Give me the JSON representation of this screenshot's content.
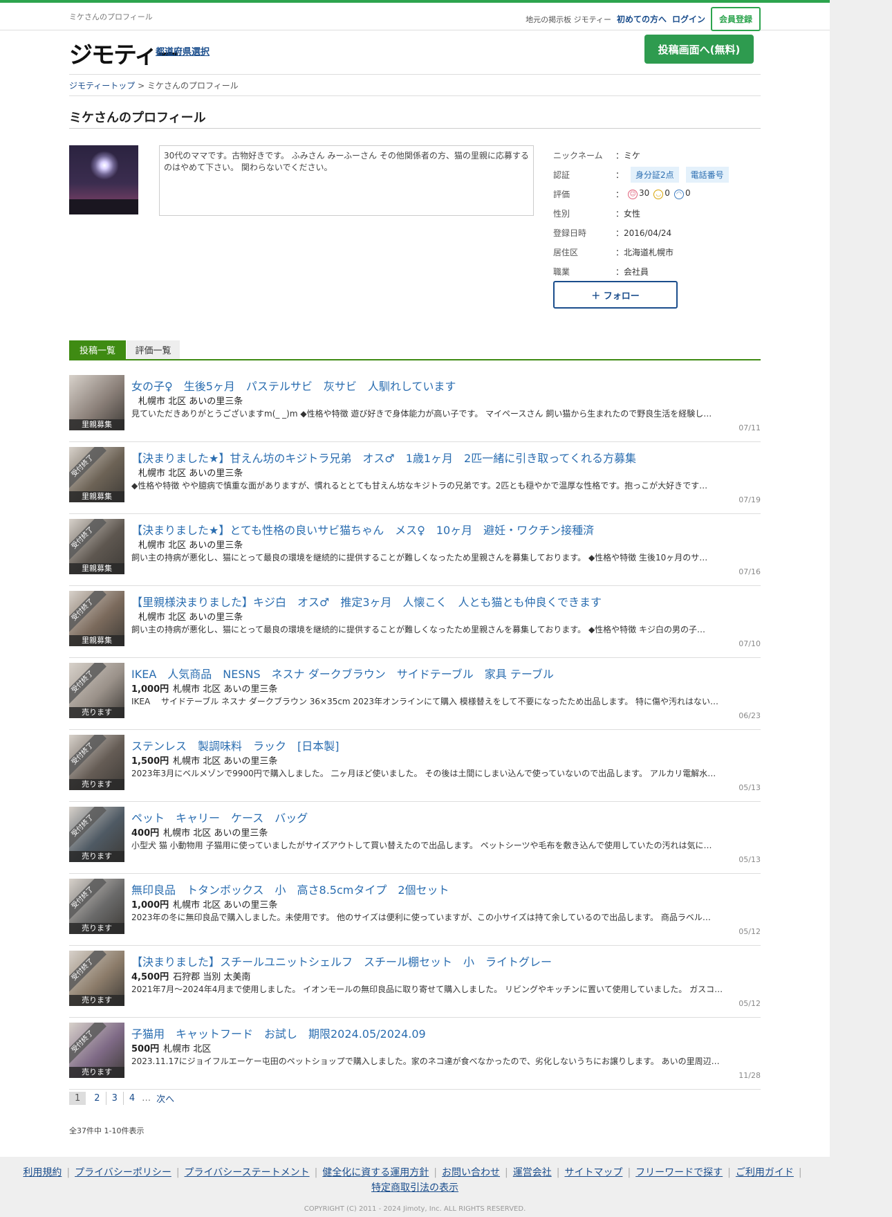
{
  "topbar": {
    "pagename": "ミケさんのプロフィール",
    "tagline": "地元の掲示板 ジモティー",
    "first_time": "初めての方へ",
    "login": "ログイン",
    "register": "会員登録"
  },
  "header": {
    "logo": "ジモティー",
    "pref": "都道府県選択",
    "post": "投稿画面へ(無料)"
  },
  "breadcrumb": {
    "home": "ジモティートップ",
    "sep": ">",
    "current": "ミケさんのプロフィール"
  },
  "profile": {
    "title": "ミケさんのプロフィール",
    "bio": "30代のママです。古物好きです。 ふみさん みーふーさん その他関係者の方、猫の里親に応募するのはやめて下さい。 関わらないでください。",
    "fields": {
      "nickname_k": "ニックネーム",
      "nickname_v": "：ミケ",
      "verify_k": "認証",
      "verify_sep": "：",
      "verify_id": "身分証2点",
      "verify_phone": "電話番号",
      "rating_k": "評価",
      "rating_sep": "：",
      "rating_good": "30",
      "rating_mid": "0",
      "rating_bad": "0",
      "gender_k": "性別",
      "gender_v": "：女性",
      "regdate_k": "登録日時",
      "regdate_v": "：2016/04/24",
      "area_k": "居住区",
      "area_v": "：北海道札幌市",
      "job_k": "職業",
      "job_v": "：会社員"
    },
    "follow": "＋ フォロー"
  },
  "tabs": {
    "posts": "投稿一覧",
    "reviews": "評価一覧"
  },
  "items": [
    {
      "title": "女の子♀　生後5ヶ月　パステルサビ　灰サビ　人馴れしています",
      "price": "",
      "place": "札幌市 北区 あいの里三条",
      "desc": "見ていただきありがとうございますm(_ _)m ◆性格や特徴 遊び好きで身体能力が高い子です。 マイペースさん 飼い猫から生まれたので野良生活を経験し…",
      "date": "07/11",
      "category": "里親募集",
      "ribbon": "",
      "color": "#8a7f78"
    },
    {
      "title": "【決まりました★】甘えん坊のキジトラ兄弟　オス♂　1歳1ヶ月　2匹一緒に引き取ってくれる方募集",
      "price": "",
      "place": "札幌市 北区 あいの里三条",
      "desc": "◆性格や特徴 やや臆病で慎重な面がありますが、慣れるととても甘えん坊なキジトラの兄弟です。2匹とも穏やかで温厚な性格です。抱っこが大好きです…",
      "date": "07/19",
      "category": "里親募集",
      "ribbon": "受付終了",
      "color": "#6d6356"
    },
    {
      "title": "【決まりました★】とても性格の良いサビ猫ちゃん　メス♀　10ヶ月　避妊・ワクチン接種済",
      "price": "",
      "place": "札幌市 北区 あいの里三条",
      "desc": "飼い主の持病が悪化し、猫にとって最良の環境を継続的に提供することが難しくなったため里親さんを募集しております。 ◆性格や特徴 生後10ヶ月のサ…",
      "date": "07/16",
      "category": "里親募集",
      "ribbon": "受付終了",
      "color": "#5e5750"
    },
    {
      "title": "【里親様決まりました】キジ白　オス♂　推定3ヶ月　人懐こく　人とも猫とも仲良くできます",
      "price": "",
      "place": "札幌市 北区 あいの里三条",
      "desc": "飼い主の持病が悪化し、猫にとって最良の環境を継続的に提供することが難しくなったため里親さんを募集しております。 ◆性格や特徴 キジ白の男の子…",
      "date": "07/10",
      "category": "里親募集",
      "ribbon": "受付終了",
      "color": "#7b6a5c"
    },
    {
      "title": "IKEA　人気商品　NESNS　ネスナ ダークブラウン　サイドテーブル　家具 テーブル",
      "price": "1,000円",
      "place": "札幌市 北区 あいの里三条",
      "desc": "IKEA　 サイドテーブル ネスナ ダークブラウン 36×35cm 2023年オンラインにて購入 模様替えをして不要になったため出品します。 特に傷や汚れはない…",
      "date": "06/23",
      "category": "売ります",
      "ribbon": "受付終了",
      "color": "#9a9189"
    },
    {
      "title": "ステンレス　製調味料　ラック　[日本製]",
      "price": "1,500円",
      "place": "札幌市 北区 あいの里三条",
      "desc": "2023年3月にベルメゾンで9900円で購入しました。 二ヶ月ほど使いました。 その後は土間にしまい込んで使っていないので出品します。 アルカリ電解水…",
      "date": "05/13",
      "category": "売ります",
      "ribbon": "受付終了",
      "color": "#655c55"
    },
    {
      "title": "ペット　キャリー　ケース　バッグ",
      "price": "400円",
      "place": "札幌市 北区 あいの里三条",
      "desc": "小型犬 猫 小動物用 子猫用に使っていましたがサイズアウトして買い替えたので出品します。 ペットシーツや毛布を敷き込んで使用していたの汚れは気に…",
      "date": "05/13",
      "category": "売ります",
      "ribbon": "受付終了",
      "color": "#4f5a64"
    },
    {
      "title": "無印良品　トタンボックス　小　高さ8.5cmタイプ　2個セット",
      "price": "1,000円",
      "place": "札幌市 北区 あいの里三条",
      "desc": "2023年の冬に無印良品で購入しました。未使用です。 他のサイズは便利に使っていますが、この小サイズは持て余しているので出品します。 商品ラベル…",
      "date": "05/12",
      "category": "売ります",
      "ribbon": "受付終了",
      "color": "#6a6a6a"
    },
    {
      "title": "【決まりました】スチールユニットシェルフ　スチール棚セット　小　ライトグレー",
      "price": "4,500円",
      "place": "石狩郡 当別 太美南",
      "desc": "2021年7月〜2024年4月まで使用しました。 イオンモールの無印良品に取り寄せて購入しました。 リビングやキッチンに置いて使用していました。 ガスコ…",
      "date": "05/12",
      "category": "売ります",
      "ribbon": "受付終了",
      "color": "#8c7c6a"
    },
    {
      "title": "子猫用　キャットフード　お試し　期限2024.05/2024.09",
      "price": "500円",
      "place": "札幌市 北区",
      "desc": "2023.11.17にジョイフルエーケー屯田のペットショップで購入しました。家のネコ達が食べなかったので、劣化しないうちにお譲りします。 あいの里周辺…",
      "date": "11/28",
      "category": "売ります",
      "ribbon": "受付終了",
      "color": "#7f6a86"
    }
  ],
  "pager": {
    "p1": "1",
    "p2": "2",
    "p3": "3",
    "p4": "4",
    "ellipsis": "…",
    "next": "次へ"
  },
  "count": "全37件中 1-10件表示",
  "footer": {
    "links": [
      "利用規約",
      "プライバシーポリシー",
      "プライバシーステートメント",
      "健全化に資する運用方針",
      "お問い合わせ",
      "運営会社",
      "サイトマップ",
      "フリーワードで探す",
      "ご利用ガイド",
      "特定商取引法の表示"
    ],
    "copyright": "COPYRIGHT (C) 2011 - 2024 Jimoty, Inc. ALL RIGHTS RESERVED."
  }
}
